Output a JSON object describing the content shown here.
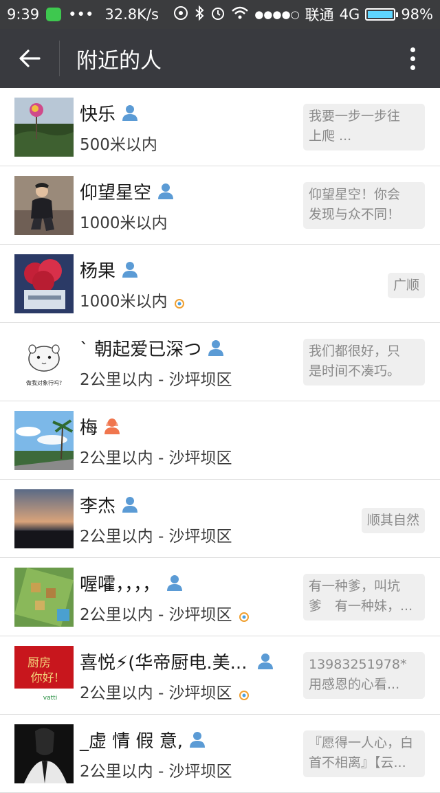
{
  "status": {
    "time": "9:39",
    "dots": "•••",
    "speed": "32.8K/s",
    "signal_dots": "●●●●○",
    "carrier": "联通",
    "network": "4G",
    "battery": "98%",
    "battery_level": 0.98
  },
  "header": {
    "title": "附近的人"
  },
  "people": [
    {
      "name": "快乐",
      "gender": "male",
      "distance": "500米以内",
      "moments": false,
      "sign_lines": [
        "我要一步一步往",
        "上爬 ..."
      ]
    },
    {
      "name": "仰望星空",
      "gender": "male",
      "distance": "1000米以内",
      "moments": false,
      "sign_lines": [
        "仰望星空！你会",
        "发现与众不同！"
      ]
    },
    {
      "name": "杨果",
      "gender": "male",
      "distance": "1000米以内",
      "moments": true,
      "sign_lines": [
        "广顺"
      ]
    },
    {
      "name": "ˋ 朝起爱已深つ",
      "gender": "male",
      "distance": "2公里以内 - 沙坪坝区",
      "moments": false,
      "sign_lines": [
        "我们都很好，只",
        "是时间不凑巧。"
      ]
    },
    {
      "name": "梅",
      "gender": "female",
      "distance": "2公里以内 - 沙坪坝区",
      "moments": false,
      "sign_lines": []
    },
    {
      "name": "李杰",
      "gender": "male",
      "distance": "2公里以内 - 沙坪坝区",
      "moments": false,
      "sign_lines": [
        "顺其自然"
      ]
    },
    {
      "name": "喔嚯，，，，",
      "gender": "male",
      "distance": "2公里以内 - 沙坪坝区",
      "moments": true,
      "sign_lines": [
        "有一种爹，叫坑",
        "爹　有一种妹，..."
      ]
    },
    {
      "name": "喜悦⚡(华帝厨电.美...",
      "gender": "male",
      "distance": "2公里以内 - 沙坪坝区",
      "moments": true,
      "sign_lines": [
        "13983251978*",
        "用感恩的心看..."
      ]
    },
    {
      "name": "_虚 情 假 意,",
      "gender": "male",
      "distance": "2公里以内 - 沙坪坝区",
      "moments": false,
      "sign_lines": [
        "『愿得一人心，白",
        "首不相离』【云..."
      ]
    }
  ],
  "avatar_text": {
    "hamster_caption": "做我对象行吗?",
    "kitchen_line1": "厨房",
    "kitchen_line2": "你好!",
    "kitchen_brand": "vatti"
  },
  "colors": {
    "male": "#5b9bd5",
    "female": "#f0764e",
    "header": "#393a3f",
    "status": "#3b3c3e"
  }
}
